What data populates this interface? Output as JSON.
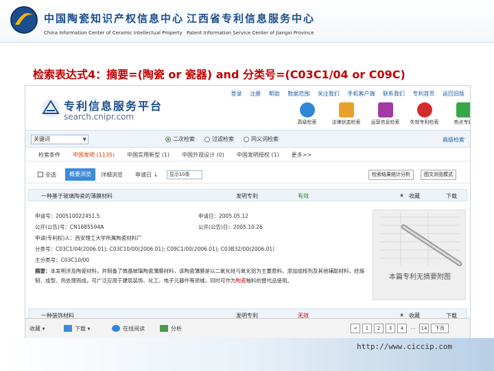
{
  "slide": {
    "org1_cn": "中国陶瓷知识产权信息中心",
    "org1_en": "China Information Center of Ceramic Intellectual Property",
    "org2_cn": "江西省专利信息服务中心",
    "org2_en": "Patent Information Service Center of Jiangxi Province",
    "title": "检索表达式4：摘要=(陶瓷 or 瓷器) and 分类号=(C03C1/04 or C09C)",
    "footer_url": "http://www.ciccip.com"
  },
  "colors": {
    "title": "#c00000",
    "brand": "#1c4d8c",
    "active_tab": "#3d8ad8",
    "valid": "#1c8a1c",
    "invalid": "#d00000"
  },
  "site": {
    "top_links": [
      "登录",
      "注册",
      "帮助",
      "数据范围",
      "关注我们",
      "手机客户端",
      "联系我们",
      "专利首页",
      "返回旧版"
    ],
    "brand_cn": "专利信息服务平台",
    "brand_en": "search.cnipr.com",
    "nav": [
      {
        "label": "高级检索",
        "icon": "search-icon",
        "color": "#2f86d6"
      },
      {
        "label": "法律状态检索",
        "icon": "magnifier-icon",
        "color": "#e9a12b"
      },
      {
        "label": "运营信息检索",
        "icon": "folder-icon",
        "color": "#a33aa3"
      },
      {
        "label": "失效专利检索",
        "icon": "alert-icon",
        "color": "#d42a2a"
      },
      {
        "label": "热点专题",
        "icon": "chart-icon",
        "color": "#3aa64a"
      }
    ]
  },
  "search": {
    "select_value": "关键词",
    "radios": [
      {
        "label": "二次检索",
        "checked": true
      },
      {
        "label": "过滤检索",
        "checked": false
      },
      {
        "label": "同义词检索",
        "checked": false
      }
    ],
    "adv_link": "高级检索"
  },
  "tabs": [
    {
      "label": "检索条件",
      "active": false
    },
    {
      "label": "中国发明 (1135)",
      "active": true
    },
    {
      "label": "中国实用新型 (1)",
      "active": false
    },
    {
      "label": "中国外观设计 (0)",
      "active": false
    },
    {
      "label": "中国发明授权 (1)",
      "active": false
    },
    {
      "label": "更多>>",
      "active": false
    }
  ],
  "toolbar": {
    "select_all": "全选",
    "view_active": "概要浏览",
    "detail": "详细浏览",
    "page_info": "申请日 ↓",
    "perpage": "显示10条",
    "mode1": "检索结果统计分析",
    "mode2": "图文浏览模式"
  },
  "record1": {
    "title": "一种基于玻璃陶瓷的薄膜材料",
    "legal_label": "发明专利",
    "status": "有效",
    "fav": "收藏",
    "download": "下载",
    "app_no_label": "申请号：",
    "app_no": "200510022451.5",
    "app_date_label": "申请日：",
    "app_date": "2005.05.12",
    "pub_no_label": "公开(公告)号：",
    "pub_no": "CN1685594A",
    "pub_date_label": "公开(公告)日：",
    "pub_date": "2005.10.26",
    "applicant_label": "申请(专利权)人：",
    "applicant": "西安理工大学所属陶瓷材料厂",
    "ipc_label": "分类号：",
    "ipc": "C03C1/04(2006.01); C03C10/00(2006.01); C09C1/00(2006.01); C03B32/00(2006.01)",
    "family_label": "主分类号：",
    "family": "C03C10/00",
    "abstract_label": "摘要：",
    "abstract_pre": "本发明涉及陶瓷材料，并制备了微晶玻璃陶瓷薄膜材料，该陶瓷薄膜是以二氧化硅与氧化铝为主要原料，添加成核剂及其他辅助材料，经熔制、成型、热处理而成，可广泛应用于建筑装饰、化工、电子元器件等领域，同时可作为",
    "abstract_hl": "陶瓷",
    "abstract_post": "釉料的替代品使用。",
    "thumb_label": "本篇专利无摘要附图"
  },
  "record2": {
    "title": "一种装饰材料",
    "legal_label": "发明专利",
    "status": "无效",
    "fav": "收藏",
    "download": "下载"
  },
  "bottom": {
    "items": [
      "收藏",
      "下载",
      "在线阅读",
      "分析"
    ],
    "pages": [
      "1",
      "2",
      "3",
      "4",
      "14",
      "下页"
    ]
  }
}
